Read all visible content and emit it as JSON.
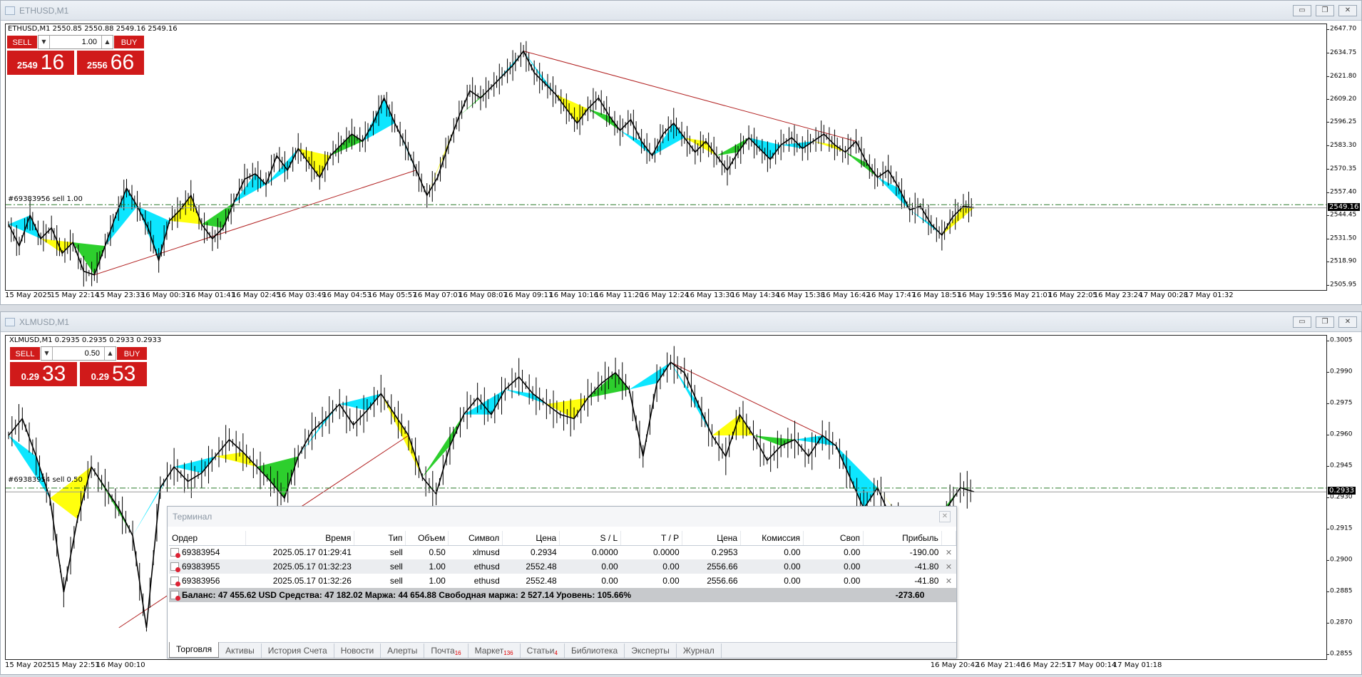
{
  "eth": {
    "window_title": "ETHUSD,M1",
    "symbol_info": "ETHUSD,M1  2550.85 2550.88 2549.16 2549.16",
    "order_label": "#69383956 sell 1.00",
    "trade": {
      "sell_label": "SELL",
      "buy_label": "BUY",
      "lot": "1.00",
      "sell_small": "2549",
      "sell_big": "16",
      "buy_small": "2556",
      "buy_big": "66"
    },
    "price_ticks": [
      "2647.70",
      "2634.75",
      "2621.80",
      "2609.20",
      "2596.25",
      "2583.30",
      "2570.35",
      "2557.40",
      "2544.45",
      "2531.50",
      "2518.90",
      "2505.95"
    ],
    "current_price": "2549.16",
    "time_ticks": [
      "15 May 2025",
      "15 May 22:14",
      "15 May 23:33",
      "16 May 00:37",
      "16 May 01:41",
      "16 May 02:45",
      "16 May 03:49",
      "16 May 04:53",
      "16 May 05:57",
      "16 May 07:01",
      "16 May 08:07",
      "16 May 09:11",
      "16 May 10:16",
      "16 May 11:20",
      "16 May 12:24",
      "16 May 13:30",
      "16 May 14:34",
      "16 May 15:38",
      "16 May 16:42",
      "16 May 17:47",
      "16 May 18:51",
      "16 May 19:55",
      "16 May 21:01",
      "16 May 22:05",
      "16 May 23:24",
      "17 May 00:28",
      "17 May 01:32"
    ],
    "series": [
      2540,
      2528,
      2545,
      2532,
      2538,
      2524,
      2530,
      2514,
      2512,
      2528,
      2545,
      2560,
      2550,
      2538,
      2520,
      2542,
      2548,
      2556,
      2540,
      2532,
      2538,
      2552,
      2565,
      2568,
      2562,
      2578,
      2570,
      2582,
      2574,
      2566,
      2578,
      2584,
      2590,
      2586,
      2596,
      2610,
      2596,
      2584,
      2570,
      2556,
      2566,
      2584,
      2600,
      2614,
      2610,
      2616,
      2622,
      2628,
      2636,
      2624,
      2618,
      2612,
      2604,
      2596,
      2604,
      2610,
      2600,
      2592,
      2598,
      2586,
      2578,
      2590,
      2596,
      2588,
      2580,
      2586,
      2578,
      2570,
      2580,
      2588,
      2582,
      2576,
      2584,
      2588,
      2582,
      2586,
      2590,
      2584,
      2580,
      2586,
      2574,
      2566,
      2570,
      2560,
      2548,
      2550,
      2540,
      2534,
      2544,
      2550,
      2549.16
    ]
  },
  "xlm": {
    "window_title": "XLMUSD,M1",
    "symbol_info": "XLMUSD,M1  0.2935 0.2935 0.2933 0.2933",
    "order_label": "#69383954 sell 0.50",
    "trade": {
      "sell_label": "SELL",
      "buy_label": "BUY",
      "lot": "0.50",
      "sell_small": "0.29",
      "sell_big": "33",
      "buy_small": "0.29",
      "buy_big": "53"
    },
    "price_ticks": [
      "0.3005",
      "0.2990",
      "0.2975",
      "0.2960",
      "0.2945",
      "0.2930",
      "0.2915",
      "0.2900",
      "0.2885",
      "0.2870",
      "0.2855"
    ],
    "current_price": "0.2933",
    "time_ticks": [
      "15 May 2025",
      "15 May 22:51",
      "16 May 00:10",
      "16 May 20:42",
      "16 May 21:46",
      "16 May 22:51",
      "17 May 00:14",
      "17 May 01:18"
    ],
    "series": [
      0.296,
      0.2968,
      0.295,
      0.293,
      0.2885,
      0.292,
      0.2945,
      0.2935,
      0.2925,
      0.2912,
      0.2868,
      0.2935,
      0.2945,
      0.2938,
      0.2942,
      0.295,
      0.2958,
      0.2952,
      0.2945,
      0.2938,
      0.293,
      0.295,
      0.2962,
      0.2968,
      0.2975,
      0.2965,
      0.2972,
      0.298,
      0.297,
      0.296,
      0.294,
      0.2932,
      0.2955,
      0.297,
      0.2978,
      0.297,
      0.2982,
      0.2988,
      0.298,
      0.2975,
      0.297,
      0.2968,
      0.2978,
      0.2985,
      0.299,
      0.2982,
      0.295,
      0.2985,
      0.2995,
      0.299,
      0.2975,
      0.296,
      0.295,
      0.297,
      0.296,
      0.2948,
      0.2955,
      0.2958,
      0.295,
      0.296,
      0.2955,
      0.294,
      0.2925,
      0.2935,
      0.292,
      0.2918,
      0.291,
      0.2895,
      0.2925,
      0.2935,
      0.2933
    ]
  },
  "terminal": {
    "title": "Терминал",
    "columns": [
      "Ордер",
      "Время",
      "Тип",
      "Объем",
      "Символ",
      "Цена",
      "S / L",
      "T / P",
      "Цена",
      "Комиссия",
      "Своп",
      "Прибыль"
    ],
    "rows": [
      {
        "order": "69383954",
        "time": "2025.05.17 01:29:41",
        "type": "sell",
        "volume": "0.50",
        "symbol": "xlmusd",
        "price": "0.2934",
        "sl": "0.0000",
        "tp": "0.0000",
        "cur_price": "0.2953",
        "commission": "0.00",
        "swap": "0.00",
        "profit": "-190.00"
      },
      {
        "order": "69383955",
        "time": "2025.05.17 01:32:23",
        "type": "sell",
        "volume": "1.00",
        "symbol": "ethusd",
        "price": "2552.48",
        "sl": "0.00",
        "tp": "0.00",
        "cur_price": "2556.66",
        "commission": "0.00",
        "swap": "0.00",
        "profit": "-41.80"
      },
      {
        "order": "69383956",
        "time": "2025.05.17 01:32:26",
        "type": "sell",
        "volume": "1.00",
        "symbol": "ethusd",
        "price": "2552.48",
        "sl": "0.00",
        "tp": "0.00",
        "cur_price": "2556.66",
        "commission": "0.00",
        "swap": "0.00",
        "profit": "-41.80"
      }
    ],
    "summary": "Баланс: 47 455.62 USD  Средства: 47 182.02  Маржа: 44 654.88  Свободная маржа: 2 527.14  Уровень: 105.66%",
    "summary_profit": "-273.60",
    "tabs": [
      {
        "label": "Торговля",
        "badge": ""
      },
      {
        "label": "Активы",
        "badge": ""
      },
      {
        "label": "История Счета",
        "badge": ""
      },
      {
        "label": "Новости",
        "badge": ""
      },
      {
        "label": "Алерты",
        "badge": ""
      },
      {
        "label": "Почта",
        "badge": "16"
      },
      {
        "label": "Маркет",
        "badge": "136"
      },
      {
        "label": "Статьи",
        "badge": "4"
      },
      {
        "label": "Библиотека",
        "badge": ""
      },
      {
        "label": "Эксперты",
        "badge": ""
      },
      {
        "label": "Журнал",
        "badge": ""
      }
    ]
  },
  "window_buttons": {
    "minimize": "▭",
    "restore": "❐",
    "close": "✕"
  },
  "colors": {
    "candle": "#000000",
    "fill_cyan": "#00e5ff",
    "fill_yellow": "#ffff00",
    "fill_green": "#22cc22",
    "level_line": "#2b7a2b",
    "trend_red": "#b22222",
    "trade_red": "#d01a1a"
  }
}
